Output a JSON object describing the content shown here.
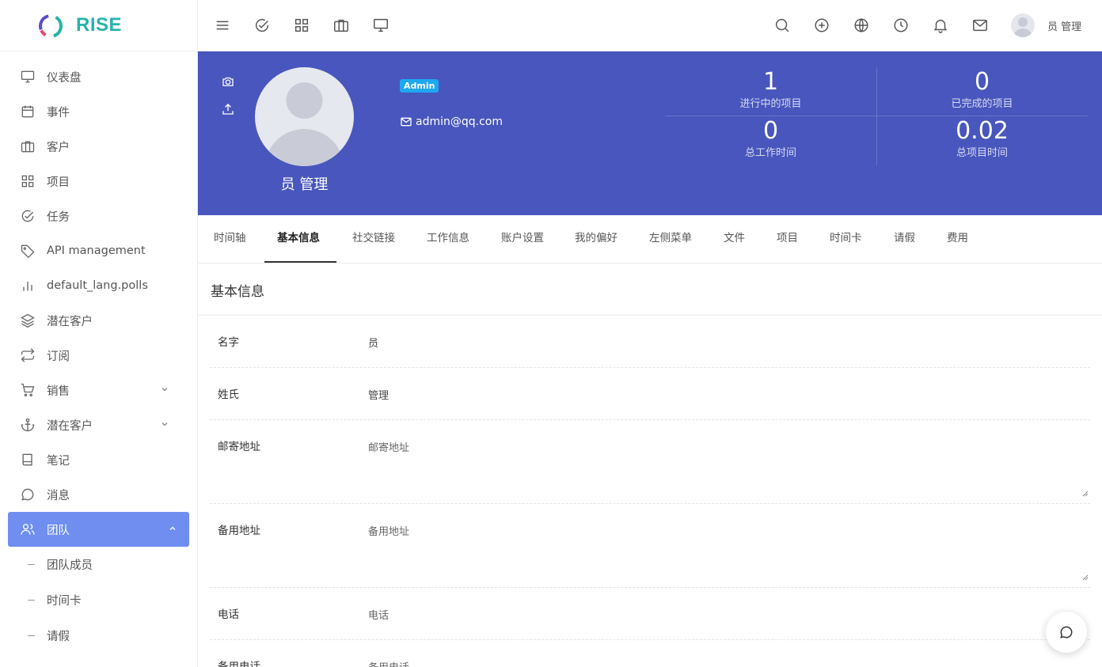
{
  "brand": {
    "name": "RISE",
    "accent": "#26b3a9"
  },
  "sidebar": {
    "items": [
      {
        "label": "仪表盘",
        "icon": "monitor-icon"
      },
      {
        "label": "事件",
        "icon": "calendar-icon"
      },
      {
        "label": "客户",
        "icon": "briefcase-icon"
      },
      {
        "label": "项目",
        "icon": "grid-icon"
      },
      {
        "label": "任务",
        "icon": "check-circle-icon"
      },
      {
        "label": "API management",
        "icon": "tag-icon"
      },
      {
        "label": "default_lang.polls",
        "icon": "bar-chart-icon"
      },
      {
        "label": "潜在客户",
        "icon": "layers-icon"
      },
      {
        "label": "订阅",
        "icon": "repeat-icon"
      },
      {
        "label": "销售",
        "icon": "cart-icon",
        "expandable": true
      },
      {
        "label": "潜在客户",
        "icon": "anchor-icon",
        "expandable": true
      },
      {
        "label": "笔记",
        "icon": "book-icon"
      },
      {
        "label": "消息",
        "icon": "message-icon"
      },
      {
        "label": "团队",
        "icon": "users-icon",
        "expandable": true,
        "active": true
      }
    ],
    "sub_items": [
      "团队成员",
      "时间卡",
      "请假"
    ],
    "active_color": "#6f8ef0"
  },
  "topbar": {
    "user_name": "员 管理"
  },
  "profile": {
    "name": "员 管理",
    "role": "Admin",
    "email": "admin@qq.com",
    "banner_color": "#4856bd",
    "stats": [
      {
        "value": "1",
        "label": "进行中的项目"
      },
      {
        "value": "0",
        "label": "已完成的项目"
      },
      {
        "value": "0",
        "label": "总工作时间"
      },
      {
        "value": "0.02",
        "label": "总项目时间"
      }
    ]
  },
  "tabs": [
    "时间轴",
    "基本信息",
    "社交链接",
    "工作信息",
    "账户设置",
    "我的偏好",
    "左侧菜单",
    "文件",
    "项目",
    "时间卡",
    "请假",
    "费用"
  ],
  "active_tab": "基本信息",
  "form": {
    "title": "基本信息",
    "fields": [
      {
        "label": "名字",
        "value": "员"
      },
      {
        "label": "姓氏",
        "value": "管理"
      },
      {
        "label": "邮寄地址",
        "placeholder": "邮寄地址"
      },
      {
        "label": "备用地址",
        "placeholder": "备用地址"
      },
      {
        "label": "电话",
        "placeholder": "电话"
      },
      {
        "label": "备用电话",
        "placeholder": "备用电话"
      }
    ]
  }
}
